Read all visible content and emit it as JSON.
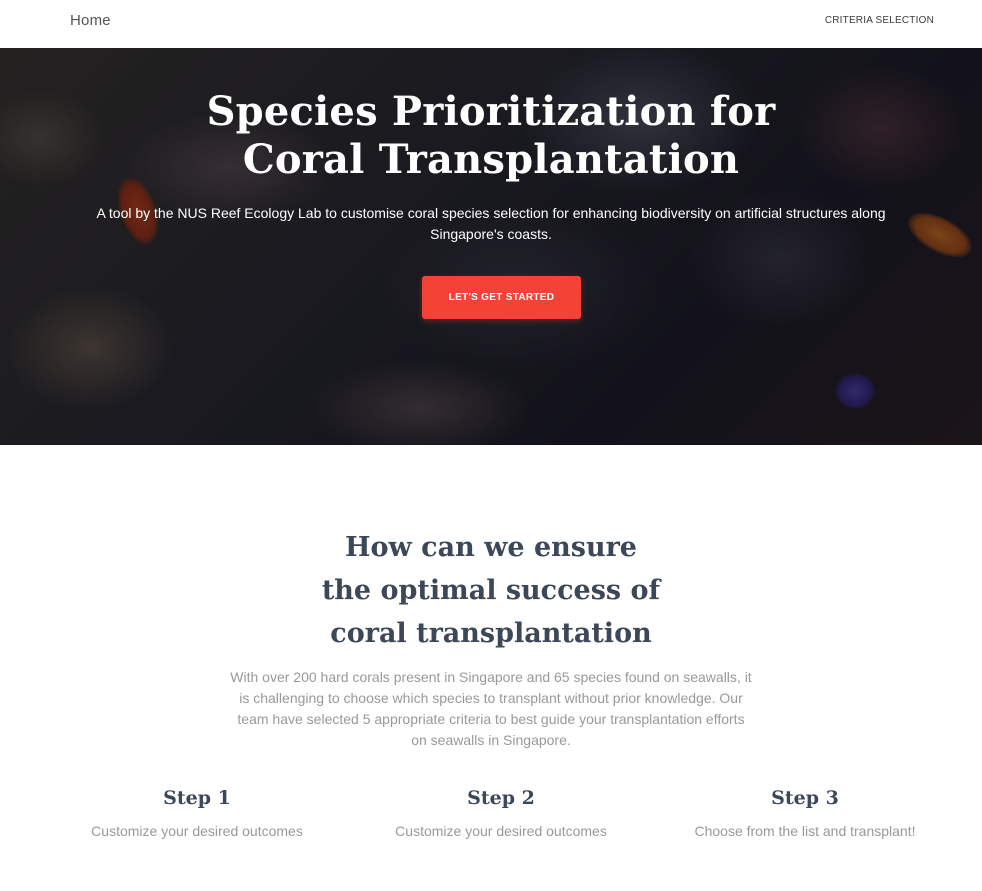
{
  "nav": {
    "brand": "Home",
    "link": "CRITERIA SELECTION"
  },
  "hero": {
    "title": "Species Prioritization for Coral Transplantation",
    "subtitle": "A tool by the NUS Reef Ecology Lab to customise coral species selection for enhancing biodiversity on artificial structures along Singapore's coasts.",
    "cta_label": "LET'S GET STARTED"
  },
  "section": {
    "title": "How can we ensure the optimal success of coral transplantation",
    "description": "With over 200 hard corals present in Singapore and 65 species found on seawalls, it is challenging to choose which species to transplant without prior knowledge. Our team have selected 5 appropriate criteria to best guide your transplantation efforts on seawalls in Singapore."
  },
  "steps": [
    {
      "title": "Step 1",
      "description": "Customize your desired outcomes"
    },
    {
      "title": "Step 2",
      "description": "Customize your desired outcomes"
    },
    {
      "title": "Step 3",
      "description": "Choose from the list and transplant!"
    }
  ],
  "colors": {
    "accent": "#f44336",
    "heading": "#3c4858",
    "muted": "#999999"
  }
}
